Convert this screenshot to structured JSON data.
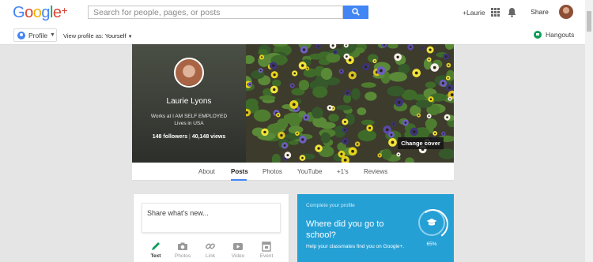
{
  "header": {
    "logo": "Google+",
    "search_placeholder": "Search for people, pages, or posts",
    "user_link": "+Laurie",
    "share_label": "Share",
    "icons": [
      "search-icon",
      "apps-icon",
      "bell-icon",
      "avatar"
    ]
  },
  "subbar": {
    "profile_label": "Profile",
    "view_as_prefix": "View profile as:",
    "view_as_value": "Yourself",
    "hangouts_label": "Hangouts"
  },
  "profile": {
    "name": "Laurie Lyons",
    "work": "Works at I AM SELF EMPLOYED",
    "lives": "Lives in USA",
    "followers": "148 followers",
    "views": "40,148 views",
    "change_cover": "Change cover"
  },
  "tabs": [
    "About",
    "Posts",
    "Photos",
    "YouTube",
    "+1's",
    "Reviews"
  ],
  "active_tab": "Posts",
  "share": {
    "placeholder": "Share what's new...",
    "options": [
      "Text",
      "Photos",
      "Link",
      "Video",
      "Event"
    ]
  },
  "complete_profile": {
    "heading": "Complete your profile",
    "question": "Where did you go to school?",
    "description": "Help your classmates find you on Google+.",
    "percent": "65%"
  },
  "colors": {
    "accent_blue": "#4285f4",
    "card_blue": "#25a0d5",
    "edit_green": "#0f9d58"
  }
}
